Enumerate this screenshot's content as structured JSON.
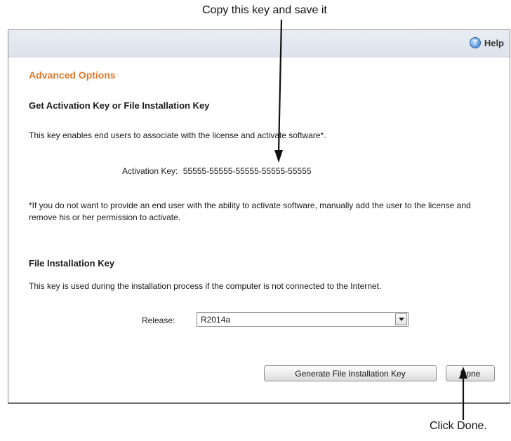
{
  "annotations": {
    "top_callout": "Copy this key and save it",
    "bottom_callout": "Click Done."
  },
  "header": {
    "help_label": "Help",
    "help_icon": "question-circle-icon"
  },
  "panel": {
    "section_title": "Advanced Options",
    "activation": {
      "heading": "Get Activation Key or File Installation Key",
      "description": "This key enables end users to associate with the license and activate software*.",
      "key_label": "Activation Key:",
      "key_value": "55555-55555-55555-55555-55555",
      "footnote": "*If you do not want to provide an end user with the ability to activate software, manually add the user to the license and remove his or her permission to activate."
    },
    "file_installation": {
      "heading": "File Installation Key",
      "description": "This key is used during the installation process if the computer is not connected to the Internet.",
      "release_label": "Release:",
      "release_value": "R2014a"
    },
    "buttons": {
      "generate": "Generate File Installation Key",
      "done": "Done"
    }
  },
  "colors": {
    "section_title": "#e0782a",
    "titlebar": "#dde3ec"
  }
}
